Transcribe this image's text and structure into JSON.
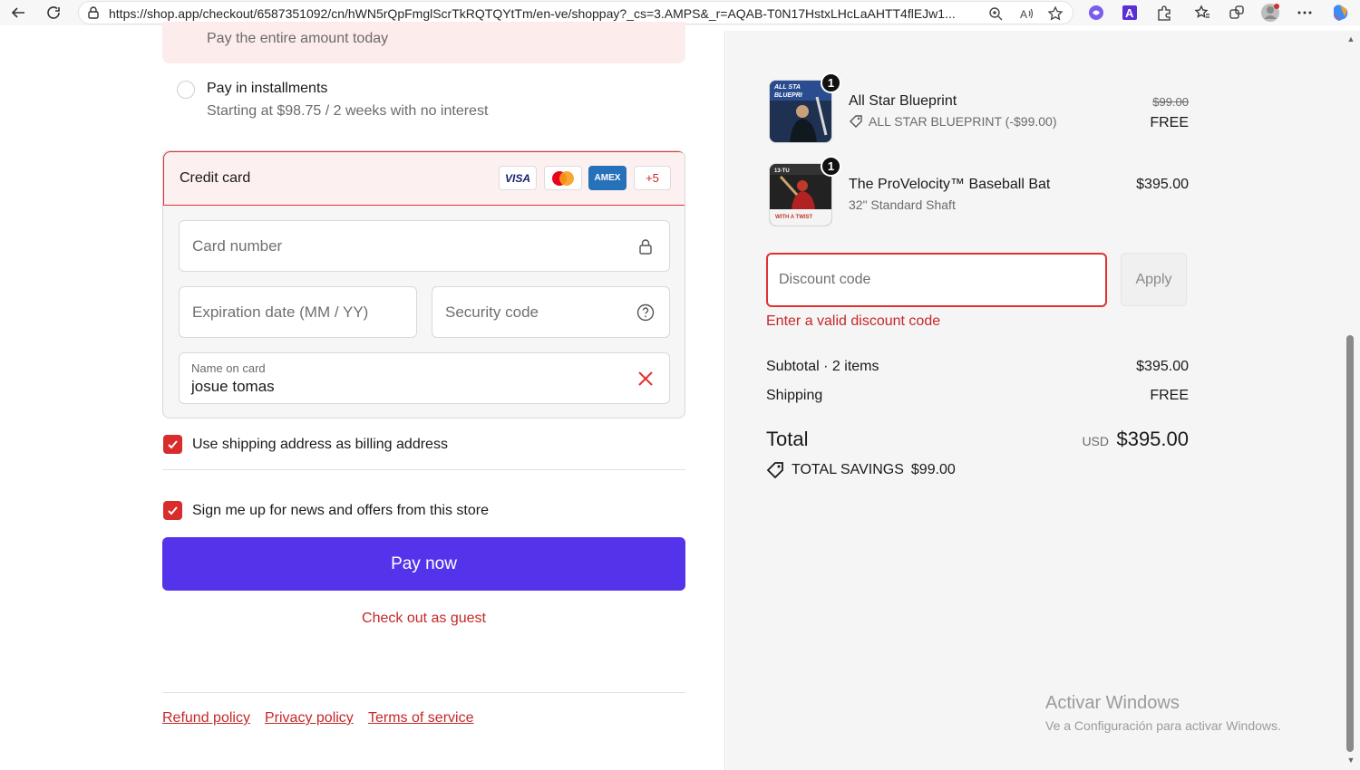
{
  "browser": {
    "url": "https://shop.app/checkout/6587351092/cn/hWN5rQpFmglScrTkRQTQYtTm/en-ve/shoppay?_cs=3.AMPS&_r=AQAB-T0N17HstxLHcLaAHTT4flEJw1..."
  },
  "payment": {
    "pay_full_label": "Pay the entire amount today",
    "installments_label": "Pay in installments",
    "installments_sub": "Starting at $98.75 / 2 weeks with no interest",
    "credit_card_label": "Credit card",
    "brands": {
      "visa": "VISA",
      "amex": "AMEX",
      "more": "+5"
    },
    "card_number_placeholder": "Card number",
    "expiration_placeholder": "Expiration date (MM / YY)",
    "security_placeholder": "Security code",
    "name_label": "Name on card",
    "name_value": "josue tomas",
    "billing_checkbox_label": "Use shipping address as billing address",
    "news_checkbox_label": "Sign me up for news and offers from this store",
    "pay_now": "Pay now",
    "guest_link": "Check out as guest"
  },
  "footer": {
    "refund": "Refund policy",
    "privacy": "Privacy policy",
    "terms": "Terms of service"
  },
  "order": {
    "items": [
      {
        "name": "All Star Blueprint",
        "discount_line": "ALL STAR BLUEPRINT (-$99.00)",
        "original_price": "$99.00",
        "price": "FREE",
        "quantity": "1",
        "thumb_text": "ALL STAR BLUEPRINT"
      },
      {
        "name": "The ProVelocity™ Baseball Bat",
        "variant": "32\" Standard Shaft",
        "price": "$395.00",
        "quantity": "1",
        "thumb_text": "WITH A TWIST"
      }
    ],
    "discount_placeholder": "Discount code",
    "apply": "Apply",
    "discount_error": "Enter a valid discount code",
    "subtotal_label": "Subtotal · 2 items",
    "subtotal_value": "$395.00",
    "shipping_label": "Shipping",
    "shipping_value": "FREE",
    "total_label": "Total",
    "currency": "USD",
    "total_value": "$395.00",
    "savings_label": "TOTAL SAVINGS",
    "savings_value": "$99.00"
  },
  "watermark": {
    "title": "Activar Windows",
    "subtitle": "Ve a Configuración para activar Windows."
  },
  "colors": {
    "accent": "#5433eb",
    "error": "#e03131",
    "link": "#c62828"
  }
}
